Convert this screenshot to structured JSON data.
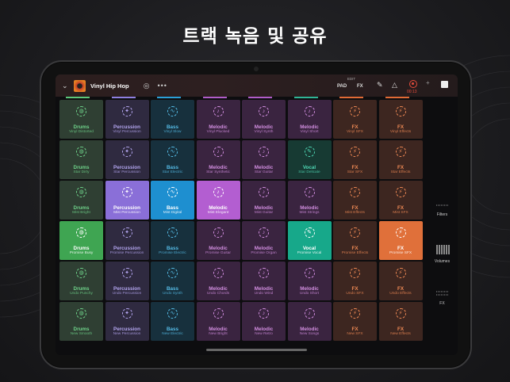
{
  "headline": "트랙 녹음 및 공유",
  "topbar": {
    "project_title": "Vinyl Hip Hop",
    "more_label": "•••",
    "edit_label": "EDIT",
    "pad_label": "PAD",
    "fx_label": "FX",
    "timer": "00:13"
  },
  "sidebar": {
    "filters_label": "Filters",
    "volumes_label": "Volumes",
    "fx_label": "FX"
  },
  "columns": [
    {
      "type": "Drums",
      "color": "#2f3f33",
      "text": "#6fd38a",
      "indicator": "#5cc87a",
      "cells": [
        "Vinyl Distorted",
        "Star Dirty",
        "Mist Bright",
        "Promise Busy",
        "Undo Punchy",
        "New Smooth"
      ]
    },
    {
      "type": "Percussion",
      "color": "#2f2a40",
      "text": "#b4a6f0",
      "indicator": "#8e7fe0",
      "cells": [
        "Vinyl Percussion",
        "Star Percussion",
        "Mist Percussion",
        "Promise Percussion",
        "Undo Percussion",
        "New Percussion"
      ]
    },
    {
      "type": "Bass",
      "color": "#17303d",
      "text": "#56bde8",
      "indicator": "#2aa0d8",
      "cells": [
        "Vinyl Slow",
        "Star Electric",
        "Mist Digital",
        "Promise Electric",
        "Undo Synth",
        "New Electric"
      ]
    },
    {
      "type": "Melodic",
      "color": "#3a2440",
      "text": "#d28ee0",
      "indicator": "#b05cc8",
      "cells": [
        "Vinyl Plucked",
        "Star Synthetic",
        "Mist Elegant",
        "Promise Guitar",
        "Undo Chords",
        "New Bright"
      ]
    },
    {
      "type": "Melodic",
      "color": "#3a2440",
      "text": "#d28ee0",
      "indicator": "#b05cc8",
      "cells": [
        "Vinyl Synth",
        "Star Guitar",
        "Mist Guitar",
        "Promise Organ",
        "Undo Wind",
        "New Retro"
      ]
    },
    {
      "type": "Melodic",
      "color": "#3a2440",
      "text": "#d28ee0",
      "indicator": "#2fb596",
      "cells": [
        "Vinyl Short",
        "Star Delicate",
        "Mist Strings",
        "Promise Vocal",
        "Undo Short",
        "New Songs"
      ]
    },
    {
      "type": "FX",
      "color": "#3d2620",
      "text": "#f08a55",
      "indicator": "#e06a35",
      "cells": [
        "Vinyl SFX",
        "Star SFX",
        "Mist Effects",
        "Promise Effects",
        "Undo SFX",
        "New SFX"
      ]
    },
    {
      "type": "FX",
      "color": "#3d2620",
      "text": "#f08a55",
      "indicator": "#e06a35",
      "cells": [
        "Vinyl Effects",
        "Star Effects",
        "Mist SFX",
        "Promise SFX",
        "Undo Effects",
        "New Effects"
      ]
    }
  ],
  "overrides": [
    {
      "col": 5,
      "row": 1,
      "type": "Vocal"
    },
    {
      "col": 5,
      "row": 3,
      "type": "Vocal"
    }
  ],
  "active_pads": [
    {
      "col": 0,
      "row": 3,
      "bg": "#3fa552"
    },
    {
      "col": 1,
      "row": 2,
      "bg": "#8a6fd8"
    },
    {
      "col": 2,
      "row": 2,
      "bg": "#1e8fd0"
    },
    {
      "col": 3,
      "row": 2,
      "bg": "#b35ed1"
    },
    {
      "col": 5,
      "row": 3,
      "bg": "#17a88a"
    },
    {
      "col": 7,
      "row": 3,
      "bg": "#e0703a"
    }
  ],
  "vocal_colors": {
    "color": "#173a33",
    "text": "#4fd6b4"
  },
  "icons": {
    "Drums": "drum-icon",
    "Percussion": "shaker-icon",
    "Bass": "wave-icon",
    "Melodic": "keys-icon",
    "Vocal": "mic-icon",
    "FX": "fx-icon"
  }
}
